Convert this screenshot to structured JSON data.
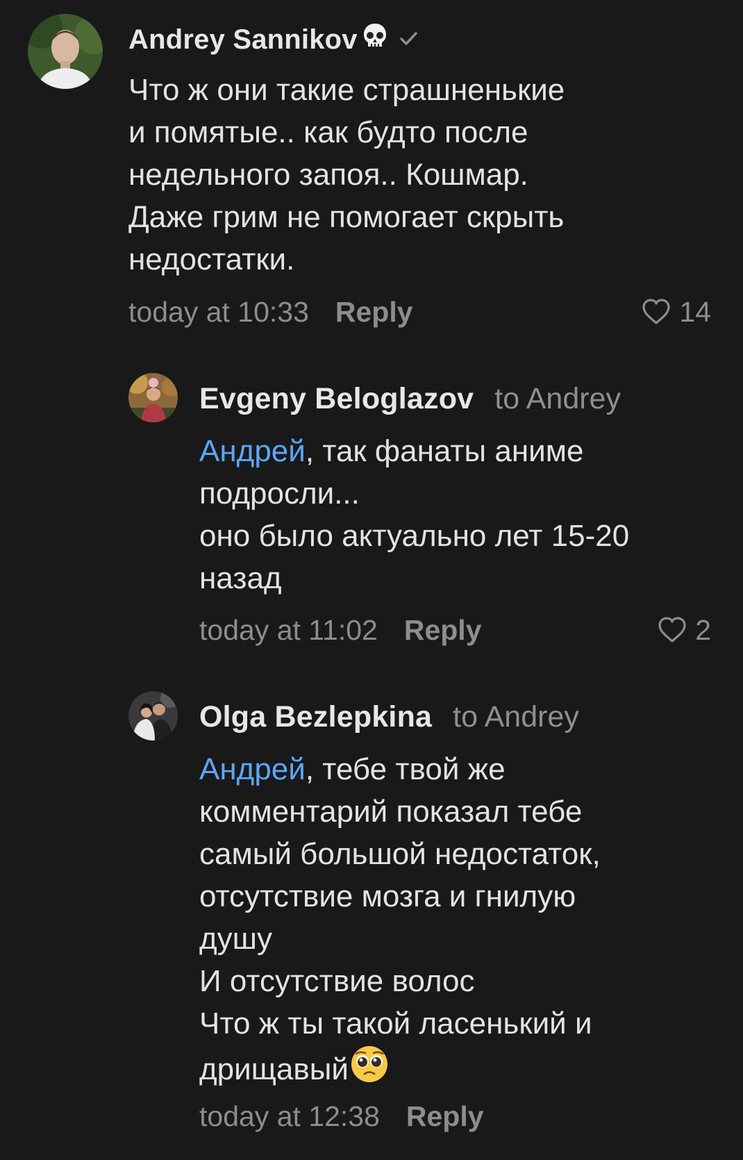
{
  "comments": [
    {
      "author": "Andrey Sannikov",
      "badge_icon": "skull-icon",
      "verified_icon": "checkmark-icon",
      "body": "Что ж они такие страшненькие\nи помятые.. как будто после\nнедельного запоя.. Кошмар.\nДаже грим не помогает скрыть\nнедостатки.",
      "time": "today at 10:33",
      "reply_label": "Reply",
      "likes": "14"
    },
    {
      "author": "Evgeny Beloglazov",
      "reply_to": "to Andrey",
      "mention": "Андрей",
      "body": ", так фанаты аниме\nподросли...\nоно было актуально лет 15-20\nназад",
      "time": "today at 11:02",
      "reply_label": "Reply",
      "likes": "2"
    },
    {
      "author": "Olga Bezlepkina",
      "reply_to": "to Andrey",
      "mention": "Андрей",
      "body": ", тебе твой же\nкомментарий показал тебе\nсамый большой недостаток,\nотсутствие мозга и гнилую\nдушу\nИ отсутствие волос\nЧто ж ты такой ласенький и\nдрищавый",
      "emoji_icon": "pleading-face-icon",
      "time": "today at 12:38",
      "reply_label": "Reply"
    }
  ],
  "colors": {
    "background": "#19191a",
    "text": "#e2e3e5",
    "muted": "#8b8d91",
    "mention": "#5ca6f7"
  }
}
